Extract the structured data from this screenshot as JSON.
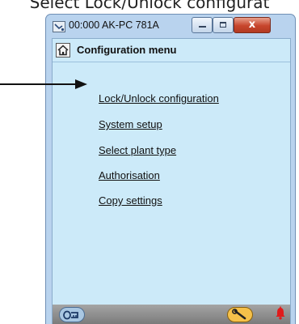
{
  "caption": "Select Lock/Unlock configurat",
  "window": {
    "title": "00:000 AK-PC 781A",
    "buttons": {
      "minimize_icon": "minimize-icon",
      "maximize_icon": "maximize-icon",
      "close_label": "x"
    }
  },
  "header": {
    "home_icon": "home-icon",
    "title": "Configuration menu"
  },
  "menu": {
    "items": [
      {
        "label": "Lock/Unlock configuration"
      },
      {
        "label": "System setup"
      },
      {
        "label": "Select plant type"
      },
      {
        "label": "Authorisation"
      },
      {
        "label": "Copy settings"
      }
    ]
  },
  "statusbar": {
    "lock_icon": "lock-icon",
    "service_icon": "wrench-icon",
    "alarm_icon": "alarm-bell-icon"
  },
  "colors": {
    "client_background": "#cceaf9",
    "window_frame": "#b9d3ee",
    "close_button": "#c7452c",
    "alarm": "#e01b1b",
    "service_button": "#f5c14a"
  }
}
